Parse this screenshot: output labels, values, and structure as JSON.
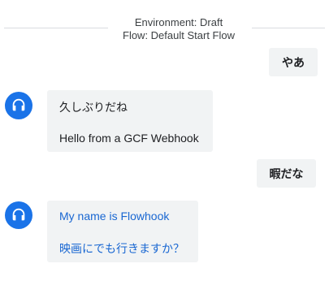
{
  "header": {
    "environment": "Environment: Draft",
    "flow": "Flow: Default Start Flow"
  },
  "messages": {
    "user1": "やあ",
    "bot1": {
      "line1": "久しぶりだね",
      "line2": "Hello from a GCF Webhook"
    },
    "user2": "暇だな",
    "bot2": {
      "line1": "My name is Flowhook",
      "line2": "映画にでも行きますか？"
    }
  },
  "colors": {
    "avatar": "#1a73e8",
    "bubble": "#f1f3f4",
    "link": "#1967d2"
  },
  "icons": {
    "avatar": "headset-icon"
  }
}
